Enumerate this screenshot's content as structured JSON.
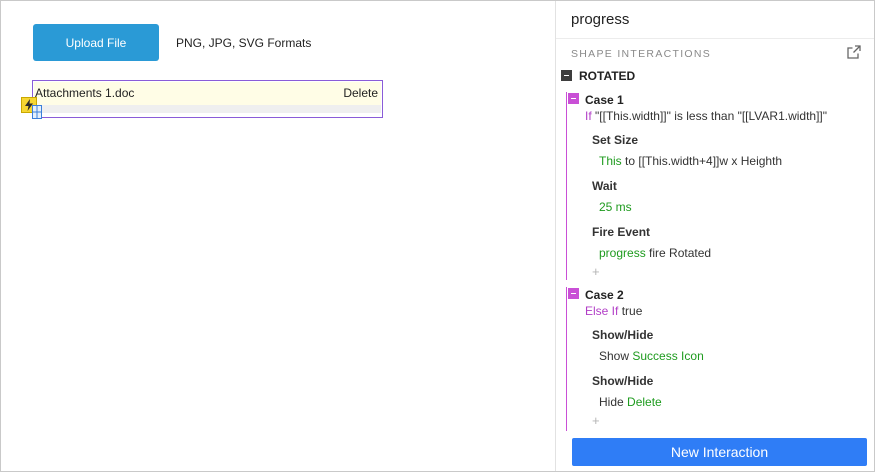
{
  "canvas": {
    "upload_button_label": "Upload File",
    "formats_text": "PNG, JPG, SVG Formats",
    "attachment": {
      "name": "Attachments 1.doc",
      "delete_label": "Delete"
    }
  },
  "panel": {
    "title": "progress",
    "section_label": "SHAPE INTERACTIONS",
    "event": {
      "label": "ROTATED",
      "cases": [
        {
          "title": "Case 1",
          "condition_keyword": "If",
          "condition_text": "\"[[This.width]]\" is less than \"[[LVAR1.width]]\"",
          "actions": [
            {
              "title": "Set Size",
              "target": "This",
              "detail": "to [[This.width+4]]w x Heighth"
            },
            {
              "title": "Wait",
              "target": "25 ms",
              "detail": ""
            },
            {
              "title": "Fire Event",
              "target": "progress",
              "detail": "fire Rotated"
            }
          ]
        },
        {
          "title": "Case 2",
          "condition_keyword": "Else If",
          "condition_text": "true",
          "actions": [
            {
              "title": "Show/Hide",
              "verb": "Show",
              "target": "Success Icon"
            },
            {
              "title": "Show/Hide",
              "verb": "Hide",
              "target": "Delete"
            }
          ]
        }
      ]
    },
    "add_symbol": "+",
    "new_interaction_label": "New Interaction"
  },
  "icons": {
    "trigger": "lightning-icon",
    "popout": "external-link-icon",
    "collapse": "minus-square-icon"
  },
  "colors": {
    "upload_button": "#2a9ad6",
    "new_interaction_button": "#2f7df6",
    "case_accent": "#c94fd6",
    "keyword": "#b13dc6",
    "target_green": "#1e9b1e",
    "selection_border": "#8a5cd8"
  }
}
